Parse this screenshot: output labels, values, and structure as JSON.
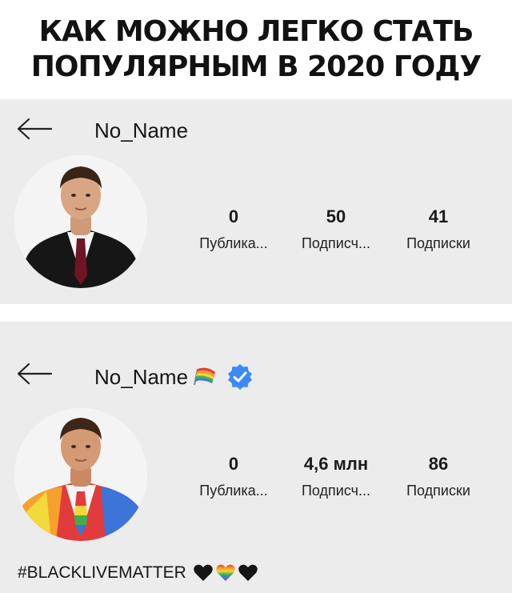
{
  "title": {
    "line1": "КАК МОЖНО ЛЕГКО СТАТЬ",
    "line2": "ПОПУЛЯРНЫМ В 2020 ГОДУ"
  },
  "profile_before": {
    "username": "No_Name",
    "stats": [
      {
        "value": "0",
        "label": "Публика..."
      },
      {
        "value": "50",
        "label": "Подписч..."
      },
      {
        "value": "41",
        "label": "Подписки"
      }
    ]
  },
  "profile_after": {
    "username": "No_Name",
    "stats": [
      {
        "value": "0",
        "label": "Публика..."
      },
      {
        "value": "4,6 млн",
        "label": "Подписч..."
      },
      {
        "value": "86",
        "label": "Подписки"
      }
    ],
    "bio": "#BLACKLIVEMATTER",
    "verified_color": "#3d8af7"
  },
  "icons": [
    "back-arrow-icon",
    "rainbow-flag-icon",
    "verified-badge-icon",
    "black-heart-icon",
    "rainbow-heart-icon"
  ]
}
